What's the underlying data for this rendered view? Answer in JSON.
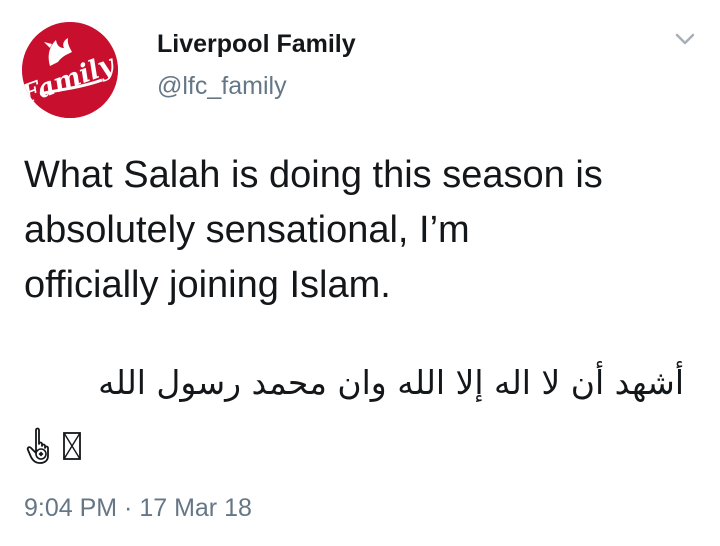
{
  "author": {
    "name": "Liverpool Family",
    "handle": "@lfc_family",
    "avatar_text": "Family"
  },
  "tweet": {
    "lines": [
      "What Salah is doing this season is",
      "absolutely sensational, I’m",
      "officially joining Islam."
    ],
    "arabic": "أشهد أن لا اله إلا الله وان محمد رسول الله"
  },
  "emojis": [
    "pointing-hand-icon",
    "missing-glyph-icon"
  ],
  "meta": {
    "timestamp": "9:04 PM · 17 Mar 18"
  },
  "colors": {
    "avatar_red": "#c8102e",
    "secondary_text": "#657786",
    "primary_text": "#14171a"
  }
}
